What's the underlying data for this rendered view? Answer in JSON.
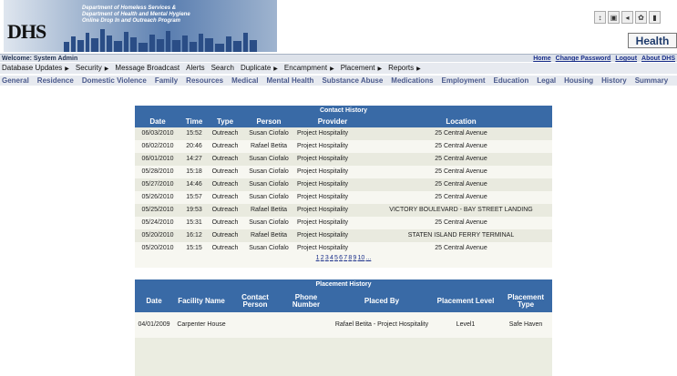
{
  "header": {
    "logo": "DHS",
    "tagline": [
      "Department of Homeless Services &",
      "Department of Health and Mental Hygiene",
      "Online Drop In and Outreach Program"
    ],
    "health_label": "Health"
  },
  "welcome": {
    "text": "Welcome: System Admin",
    "links": [
      "Home",
      "Change Password",
      "Logout",
      "About DHS"
    ]
  },
  "menu_primary": [
    {
      "label": "Database Updates",
      "arrow": true
    },
    {
      "label": "Security",
      "arrow": true
    },
    {
      "label": "Message Broadcast",
      "arrow": false
    },
    {
      "label": "Alerts",
      "arrow": false
    },
    {
      "label": "Search",
      "arrow": false
    },
    {
      "label": "Duplicate",
      "arrow": true
    },
    {
      "label": "Encampment",
      "arrow": true
    },
    {
      "label": "Placement",
      "arrow": true
    },
    {
      "label": "Reports",
      "arrow": true
    }
  ],
  "menu_secondary": [
    "General",
    "Residence",
    "Domestic Violence",
    "Family",
    "Resources",
    "Medical",
    "Mental Health",
    "Substance Abuse",
    "Medications",
    "Employment",
    "Education",
    "Legal",
    "Housing",
    "History",
    "Summary"
  ],
  "contact_history": {
    "title": "Contact History",
    "columns": [
      "Date",
      "Time",
      "Type",
      "Person",
      "Provider",
      "Location"
    ],
    "rows": [
      [
        "06/03/2010",
        "15:52",
        "Outreach",
        "Susan Ciofalo",
        "Project Hospitality",
        "25 Central Avenue"
      ],
      [
        "06/02/2010",
        "20:46",
        "Outreach",
        "Rafael Betita",
        "Project Hospitality",
        "25 Central Avenue"
      ],
      [
        "06/01/2010",
        "14:27",
        "Outreach",
        "Susan Ciofalo",
        "Project Hospitality",
        "25 Central Avenue"
      ],
      [
        "05/28/2010",
        "15:18",
        "Outreach",
        "Susan Ciofalo",
        "Project Hospitality",
        "25 Central Avenue"
      ],
      [
        "05/27/2010",
        "14:46",
        "Outreach",
        "Susan Ciofalo",
        "Project Hospitality",
        "25 Central Avenue"
      ],
      [
        "05/26/2010",
        "15:57",
        "Outreach",
        "Susan Ciofalo",
        "Project Hospitality",
        "25 Central Avenue"
      ],
      [
        "05/25/2010",
        "19:53",
        "Outreach",
        "Rafael Betita",
        "Project Hospitality",
        "VICTORY BOULEVARD - BAY STREET LANDING"
      ],
      [
        "05/24/2010",
        "15:31",
        "Outreach",
        "Susan Ciofalo",
        "Project Hospitality",
        "25 Central Avenue"
      ],
      [
        "05/20/2010",
        "16:12",
        "Outreach",
        "Rafael Betita",
        "Project Hospitality",
        "STATEN ISLAND FERRY TERMINAL"
      ],
      [
        "05/20/2010",
        "15:15",
        "Outreach",
        "Susan Ciofalo",
        "Project Hospitality",
        "25 Central Avenue"
      ]
    ],
    "pages": [
      "1",
      "2",
      "3",
      "4",
      "5",
      "6",
      "7",
      "8",
      "9",
      "10",
      "..."
    ]
  },
  "placement_history": {
    "title": "Placement History",
    "columns": [
      "Date",
      "Facility Name",
      "Contact Person",
      "Phone Number",
      "Placed By",
      "Placement Level",
      "Placement Type"
    ],
    "rows": [
      [
        "04/01/2009",
        "Carpenter House",
        "",
        "",
        "Rafael Betita - Project Hospitality",
        "Level1",
        "Safe Haven"
      ]
    ]
  }
}
